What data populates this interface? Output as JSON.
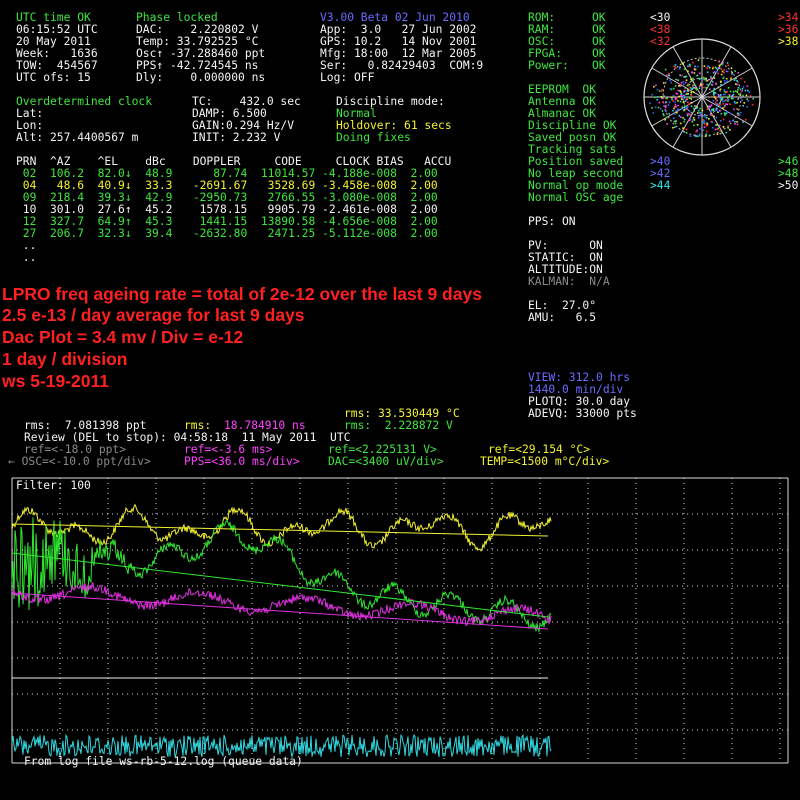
{
  "status": {
    "utc_label": "UTC time OK",
    "time": "06:15:52 UTC",
    "date": "20 May 2011",
    "week": "Week:   1636",
    "tow": "TOW:  454567",
    "utc_ofs": "UTC ofs: 15"
  },
  "receiver": {
    "phase_label": "Phase locked",
    "dac": "DAC:    2.220802 V",
    "temp": "Temp: 33.792525 °C",
    "osc": "Osc↑ -37.288460 ppt",
    "pps": "PPS↑ -42.724545 ns",
    "dly": "Dly:    0.000000 ns"
  },
  "version": {
    "title": "V3.00 Beta 02 Jun 2010",
    "app": "App:  3.0   27 Jun 2002",
    "gps": "GPS: 10.2   14 Nov 2001",
    "mfg": "Mfg: 18:00  12 Mar 2005",
    "ser": "Ser:   0.82429403  COM:9",
    "log": "Log: OFF"
  },
  "health": [
    {
      "label": "ROM:",
      "value": "OK"
    },
    {
      "label": "RAM:",
      "value": "OK"
    },
    {
      "label": "OSC:",
      "value": "OK"
    },
    {
      "label": "FPGA:",
      "value": "OK"
    },
    {
      "label": "Power:",
      "value": "OK"
    }
  ],
  "status_list": [
    "EEPROM  OK",
    "Antenna OK",
    "Almanac OK",
    "Discipline OK",
    "Saved posn OK",
    "Tracking sats",
    "Position saved",
    "No leap second",
    "Normal op mode",
    "Normal OSC age"
  ],
  "sky_labels": {
    "tl": [
      "<30",
      "<38",
      "<32"
    ],
    "tr": [
      ">34",
      ">36",
      ">38"
    ],
    "bl": [
      ">40",
      ">42",
      ">44"
    ],
    "br": [
      ">46",
      ">48",
      ">50"
    ]
  },
  "discipline": {
    "title": "Overdetermined clock",
    "lat": "Lat:",
    "lon": "Lon:",
    "alt": "Alt: 257.4400567 m",
    "tc": "TC:    432.0 sec",
    "damp": "DAMP: 6.500",
    "gain": "GAIN:0.294 Hz/V",
    "init": "INIT: 2.232 V",
    "mode_label": "Discipline mode:",
    "mode": "Normal",
    "holdover": "Holdover: 61 secs",
    "fixes": "Doing fixes"
  },
  "sat_table": {
    "header": "PRN  ^AZ    ^EL    dBc    DOPPLER     CODE     CLOCK BIAS   ACCU",
    "rows": [
      {
        "text": " 02  106.2  82.0↓  48.9      87.74  11014.57 -4.188e-008  2.00",
        "color": "#3ee63e"
      },
      {
        "text": " 04   48.6  40.9↓  33.3   -2691.67   3528.69 -3.458e-008  2.00",
        "color": "#f2f230"
      },
      {
        "text": " 09  218.4  39.3↓  42.9   -2950.73   2766.55 -3.080e-008  2.00",
        "color": "#3ee63e"
      },
      {
        "text": " 10  301.0  27.6↑  45.2    1578.15   9905.79 -2.461e-008  2.00",
        "color": "#f4f4f4"
      },
      {
        "text": " 12  327.7  64.9↑  45.3    1441.15  13890.58 -4.656e-008  2.00",
        "color": "#3ee63e"
      },
      {
        "text": " 27  206.7  32.3↓  39.4   -2632.80   2471.25 -5.112e-008  2.00",
        "color": "#3ee63e"
      },
      {
        "text": " ..",
        "color": "#f4f4f4"
      },
      {
        "text": " ..",
        "color": "#f4f4f4"
      }
    ]
  },
  "pps_state": "PPS: ON",
  "nav": {
    "pv": "PV:      ON",
    "static": "STATIC:  ON",
    "altitude": "ALTITUDE:ON",
    "kalman": "KALMAN:  N/A",
    "el": "EL:  27.0°",
    "amu": "AMU:   6.5"
  },
  "notes": [
    "LPRO freq ageing rate = total of 2e-12 over the last 9 days",
    "2.5 e-13 / day average for last 9 days",
    "Dac Plot = 3.4 mv / Div = e-12",
    "1 day / division",
    "ws 5-19-2011"
  ],
  "view": {
    "view": "VIEW: 312.0 hrs",
    "scale": "1440.0 min/div",
    "plotq": "PLOTQ: 30.0 day",
    "adevq": "ADEVQ: 33000 pts"
  },
  "stats": {
    "rms_temp": "rms: 33.530449 °C",
    "rms_ppt": "rms:  7.081398 ppt",
    "rms_ns_label": "rms:",
    "rms_ns_value": "18.784910 ns",
    "rms_v": "rms:  2.228872 V",
    "review": "Review (DEL to stop): 04:58:18  11 May 2011  UTC"
  },
  "refs": {
    "osc_ref": "ref=<-18.0 ppt>",
    "pps_ref": "ref=<-3.6 ms>",
    "dac_ref": "ref=<2.225131 V>",
    "temp_ref": "ref=<29.154 °C>",
    "osc_scale": "← OSC=<-10.0 ppt/div>",
    "pps_scale": "PPS=<36.0 ms/div>",
    "dac_scale": "DAC=<3400 uV/div>",
    "temp_scale": "TEMP=<1500 m°C/div>"
  },
  "plot": {
    "filter": "Filter: 100",
    "footer": "From log file ws-rb-5-12.log (queue data)",
    "colors": {
      "temp": "#f2f230",
      "dac": "#30e830",
      "pps": "#e030e0",
      "osc": "#30d8e0",
      "grid": "#d8d8d8"
    }
  }
}
